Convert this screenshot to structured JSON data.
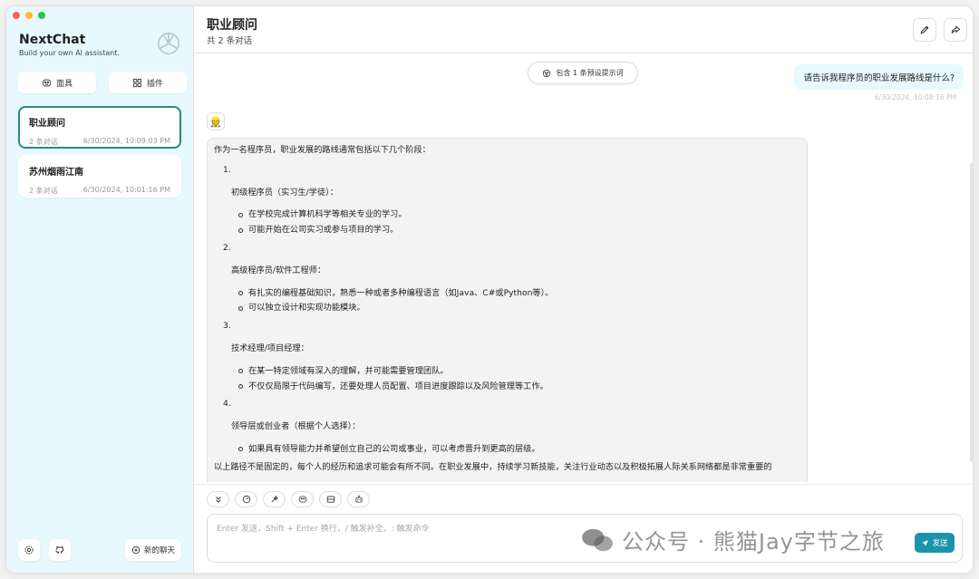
{
  "sidebar": {
    "title": "NextChat",
    "subtitle": "Build your own AI assistant.",
    "mask_label": "面具",
    "plugin_label": "插件",
    "chats": [
      {
        "title": "职业顾问",
        "count": "2 条对话",
        "time": "6/30/2024, 10:09:03 PM",
        "active": true
      },
      {
        "title": "苏州烟雨江南",
        "count": "2 条对话",
        "time": "6/30/2024, 10:01:16 PM",
        "active": false
      }
    ],
    "new_chat_label": "新的聊天"
  },
  "header": {
    "title": "职业顾问",
    "subtitle": "共 2 条对话"
  },
  "chat": {
    "prompt_pill": "包含 1 条预设提示词",
    "user_message": "请告诉我程序员的职业发展路线是什么?",
    "user_time": "6/30/2024, 10:08:16 PM",
    "bot_avatar": "👷",
    "bot_intro": "作为一名程序员，职业发展的路线通常包括以下几个阶段：",
    "stages": [
      {
        "num": "1.",
        "title": "初级程序员（实习生/学徒）：",
        "points": [
          "在学校完成计算机科学等相关专业的学习。",
          "可能开始在公司实习或参与项目的学习。"
        ]
      },
      {
        "num": "2.",
        "title": "高级程序员/软件工程师：",
        "points": [
          "有扎实的编程基础知识，熟悉一种或者多种编程语言（如Java、C#或Python等）。",
          "可以独立设计和实现功能模块。"
        ]
      },
      {
        "num": "3.",
        "title": "技术经理/项目经理：",
        "points": [
          "在某一特定领域有深入的理解，并可能需要管理团队。",
          "不仅仅局限于代码编写，还要处理人员配置、项目进度跟踪以及风险管理等工作。"
        ]
      },
      {
        "num": "4.",
        "title": "领导层或创业者（根据个人选择）：",
        "points": [
          "如果具有领导能力并希望创立自己的公司或事业，可以考虑晋升到更高的层级。"
        ]
      }
    ],
    "bot_closing": "以上路径不是固定的，每个人的经历和追求可能会有所不同。在职业发展中，持续学习新技能，关注行业动态以及积极拓展人际关系网络都是非常重要的"
  },
  "composer": {
    "placeholder": "Enter 发送，Shift + Enter 换行，/ 触发补全，: 触发命令",
    "send_label": "发送"
  },
  "watermark": "公众号 · 熊猫Jay字节之旅",
  "colors": {
    "accent": "#2d8a82",
    "sidebar_bg": "#e7f8ff",
    "send": "#1d93ab"
  }
}
